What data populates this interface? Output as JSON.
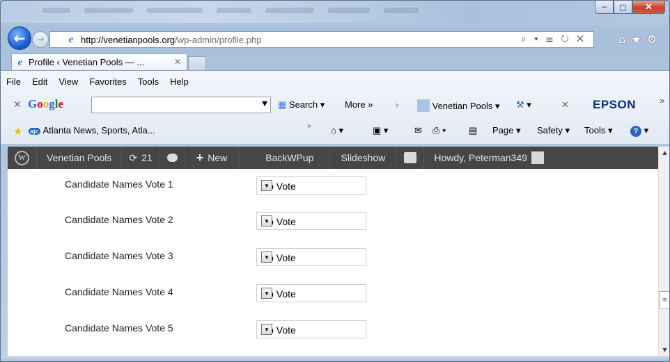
{
  "browser": {
    "url_domain": "http://venetianpools.org",
    "url_path": "/wp-admin/profile.php",
    "url_tools": "⌕ ▾ ☰ ↻ ✕",
    "tab_title": "Profile ‹ Venetian Pools — ...",
    "tab_close": "✕",
    "menu": [
      "File",
      "Edit",
      "View",
      "Favorites",
      "Tools",
      "Help"
    ],
    "google_bar": {
      "close": "✕",
      "logo": "Google",
      "search_label": "Search ▾",
      "more_label": "More »",
      "account_label": "Venetian Pools ▾",
      "wrench": "▾",
      "close2": "✕",
      "epson": "EPSON",
      "overflow": "»"
    },
    "favorites_bar": {
      "ajc_badge": "ajc",
      "ajc_link": "Atlanta News, Sports, Atla...",
      "overflow": "»",
      "home_arrow": "▾",
      "feeds_arrow": "▾",
      "print_arrow": "▾",
      "page": "Page ▾",
      "safety": "Safety ▾",
      "tools": "Tools ▾",
      "help_arrow": "▾"
    }
  },
  "adminbar": {
    "site_name": "Venetian Pools",
    "updates_count": "21",
    "new_label": "New",
    "backwpup": "BackWPup",
    "slideshow": "Slideshow",
    "howdy": "Howdy, Peterman349"
  },
  "votes": [
    {
      "label": "Candidate Names Vote 1",
      "value": "No Vote"
    },
    {
      "label": "Candidate Names Vote 2",
      "value": "No Vote"
    },
    {
      "label": "Candidate Names Vote 3",
      "value": "No Vote"
    },
    {
      "label": "Candidate Names Vote 4",
      "value": "No Vote"
    },
    {
      "label": "Candidate Names Vote 5",
      "value": "No Vote"
    }
  ]
}
